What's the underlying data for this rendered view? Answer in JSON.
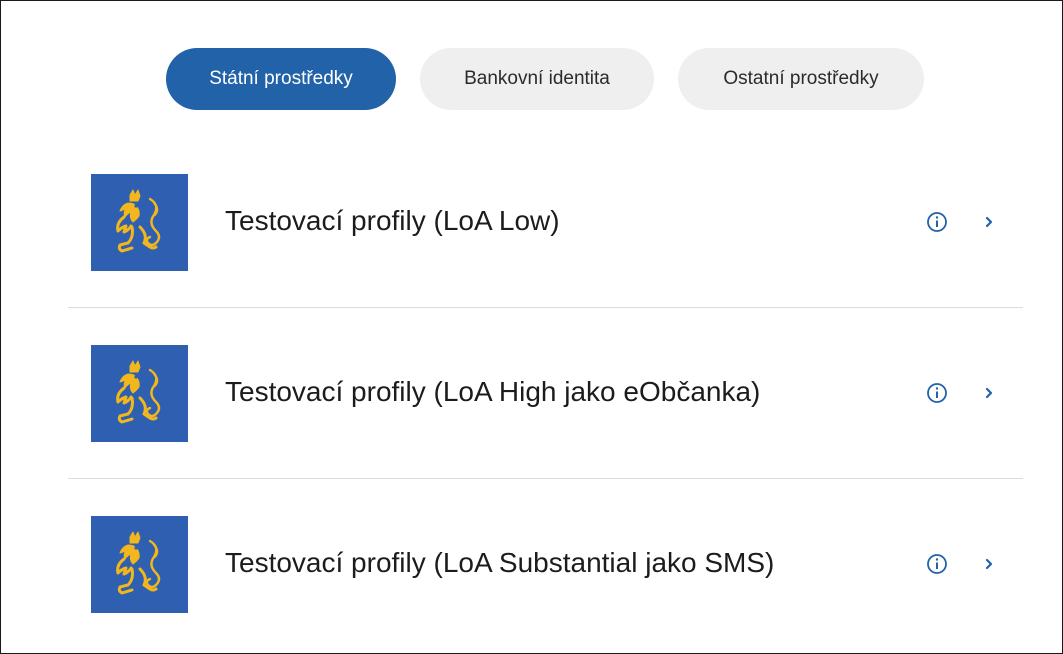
{
  "tabs": [
    {
      "label": "Státní prostředky",
      "active": true
    },
    {
      "label": "Bankovní identita",
      "active": false
    },
    {
      "label": "Ostatní prostředky",
      "active": false
    }
  ],
  "items": [
    {
      "label": "Testovací profily (LoA Low)",
      "icon": "czech-lion-emblem-icon"
    },
    {
      "label": "Testovací profily (LoA High jako eObčanka)",
      "icon": "czech-lion-emblem-icon"
    },
    {
      "label": "Testovací profily (LoA Substantial jako SMS)",
      "icon": "czech-lion-emblem-icon"
    }
  ],
  "colors": {
    "accent": "#2262a8",
    "tab_inactive_bg": "#efefef",
    "emblem_bg": "#2f5fb1",
    "emblem_gold": "#f1b71c"
  },
  "row_icons": [
    "info-icon",
    "chevron-right-icon"
  ]
}
